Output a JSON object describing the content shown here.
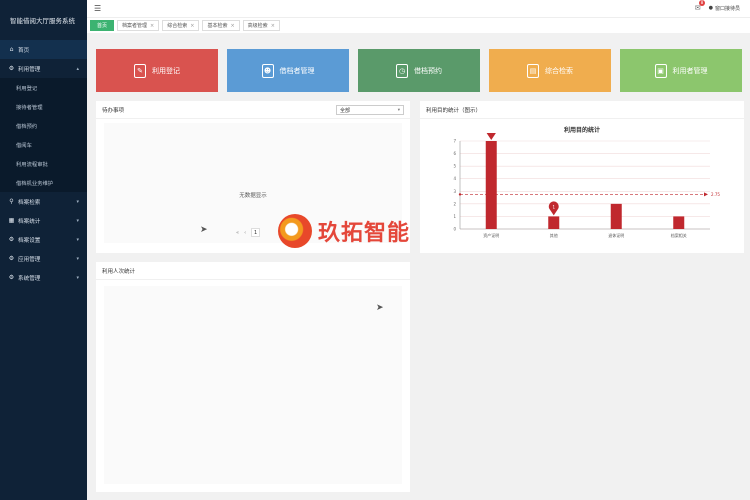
{
  "sidebar": {
    "title": "智能借阅大厅服务系统",
    "items": [
      {
        "label": "首页",
        "icon": "home-icon"
      },
      {
        "label": "利用管理",
        "icon": "gear-icon"
      },
      {
        "label": "档案检索",
        "icon": "search-icon"
      },
      {
        "label": "档案统计",
        "icon": "chart-icon"
      },
      {
        "label": "档案设置",
        "icon": "gear-icon"
      },
      {
        "label": "应用管理",
        "icon": "gear-icon"
      },
      {
        "label": "系统管理",
        "icon": "gear-icon"
      }
    ],
    "subitems": [
      "利用登记",
      "接待者管理",
      "借档预约",
      "借阅车",
      "利用流程审批",
      "借档机业务维护"
    ]
  },
  "topbar": {
    "badge": "8",
    "user": "窗口接待员"
  },
  "tabs": [
    {
      "label": "首页"
    },
    {
      "label": "档案者管理"
    },
    {
      "label": "综合检索"
    },
    {
      "label": "基本检索"
    },
    {
      "label": "高级检索"
    }
  ],
  "cards": [
    {
      "label": "利用登记",
      "color": "#d9534f"
    },
    {
      "label": "借档者管理",
      "color": "#5b9bd5"
    },
    {
      "label": "借档预约",
      "color": "#5a9a6a"
    },
    {
      "label": "综合检索",
      "color": "#f0ad4e"
    },
    {
      "label": "利用者管理",
      "color": "#8cc66d"
    }
  ],
  "todo": {
    "title": "待办事项",
    "select": "全部",
    "empty": "无数据显示",
    "page": "1"
  },
  "stats": {
    "title": "利用目的统计（图示）"
  },
  "chart_data": {
    "type": "bar",
    "title": "利用目的统计",
    "categories": [
      "资产证明",
      "其他",
      "退休证明",
      "档案相关"
    ],
    "values": [
      7,
      1,
      2,
      1
    ],
    "ylim": [
      0,
      7
    ],
    "yticks": [
      "0",
      "1",
      "2",
      "3",
      "4",
      "5",
      "6",
      "7"
    ],
    "markline_label": "2.75",
    "pin_labels": [
      "7",
      "1"
    ],
    "bar_color": "#c0282e",
    "grid": true
  },
  "people": {
    "title": "利用人次统计"
  },
  "watermark": {
    "text": "玖拓智能"
  }
}
